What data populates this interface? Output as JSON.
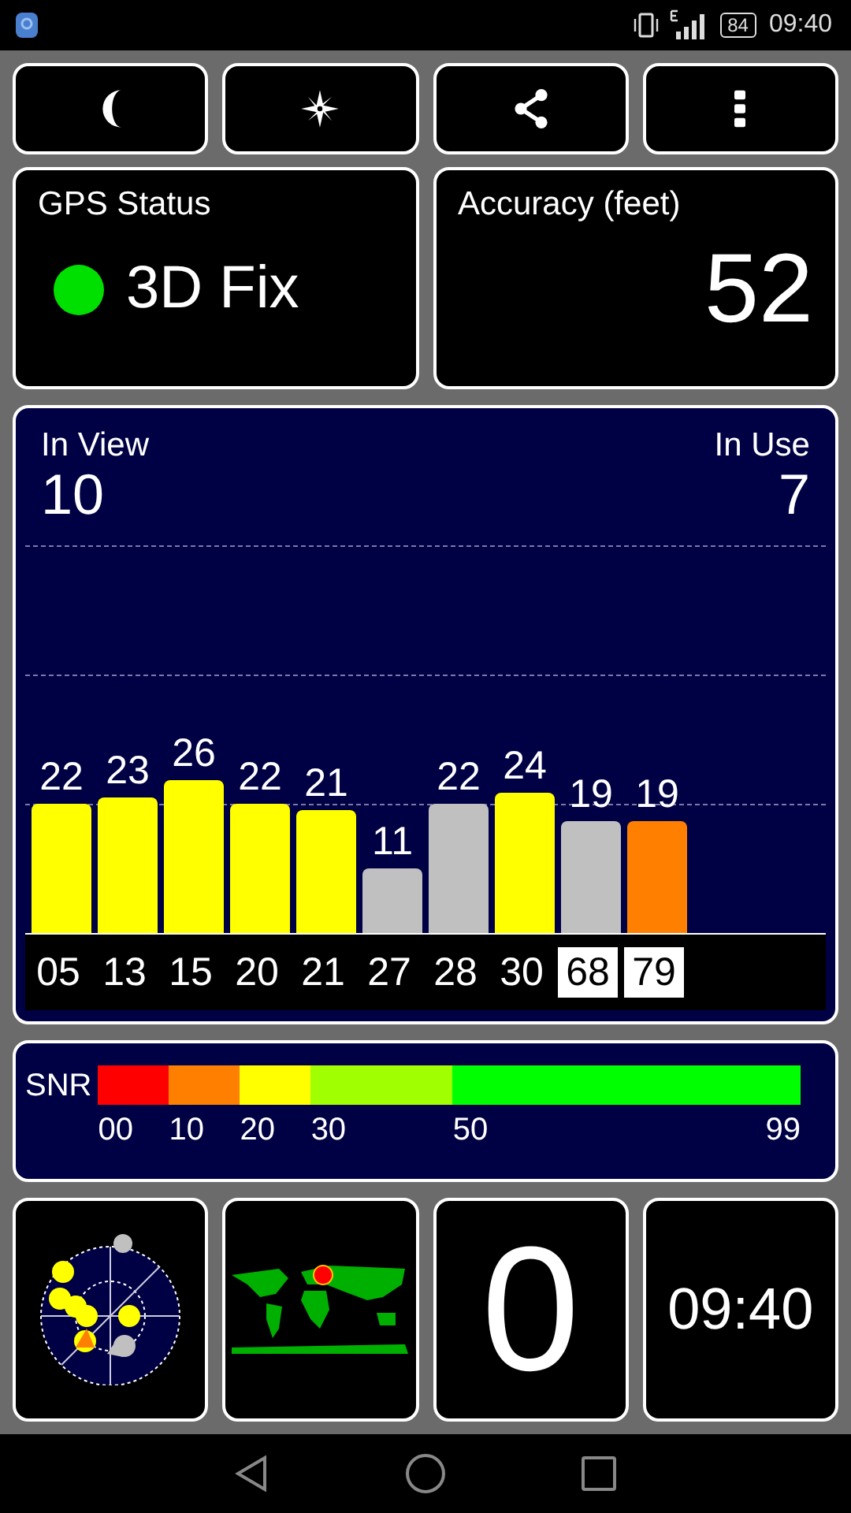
{
  "status_bar": {
    "battery": "84",
    "time": "09:40"
  },
  "gps_status": {
    "label": "GPS Status",
    "value": "3D Fix",
    "fixed": true
  },
  "accuracy": {
    "label": "Accuracy (feet)",
    "value": "52"
  },
  "satellites": {
    "in_view_label": "In View",
    "in_view": "10",
    "in_use_label": "In Use",
    "in_use": "7",
    "items": [
      {
        "prn": "05",
        "snr": "22",
        "color": "#ffff00",
        "highlighted": false
      },
      {
        "prn": "13",
        "snr": "23",
        "color": "#ffff00",
        "highlighted": false
      },
      {
        "prn": "15",
        "snr": "26",
        "color": "#ffff00",
        "highlighted": false
      },
      {
        "prn": "20",
        "snr": "22",
        "color": "#ffff00",
        "highlighted": false
      },
      {
        "prn": "21",
        "snr": "21",
        "color": "#ffff00",
        "highlighted": false
      },
      {
        "prn": "27",
        "snr": "11",
        "color": "#c0c0c0",
        "highlighted": false
      },
      {
        "prn": "28",
        "snr": "22",
        "color": "#c0c0c0",
        "highlighted": false
      },
      {
        "prn": "30",
        "snr": "24",
        "color": "#ffff00",
        "highlighted": false
      },
      {
        "prn": "68",
        "snr": "19",
        "color": "#c0c0c0",
        "highlighted": true
      },
      {
        "prn": "79",
        "snr": "19",
        "color": "#ff8000",
        "highlighted": true
      }
    ]
  },
  "snr_legend": {
    "label": "SNR",
    "end_label": "99",
    "segments": [
      {
        "label": "00",
        "color": "#ff0000"
      },
      {
        "label": "10",
        "color": "#ff8000"
      },
      {
        "label": "20",
        "color": "#ffff00"
      },
      {
        "label": "30",
        "color": "#a0ff00"
      },
      {
        "label": "50",
        "color": "#00ff00"
      }
    ]
  },
  "tiles": {
    "counter": "0",
    "clock": "09:40"
  }
}
